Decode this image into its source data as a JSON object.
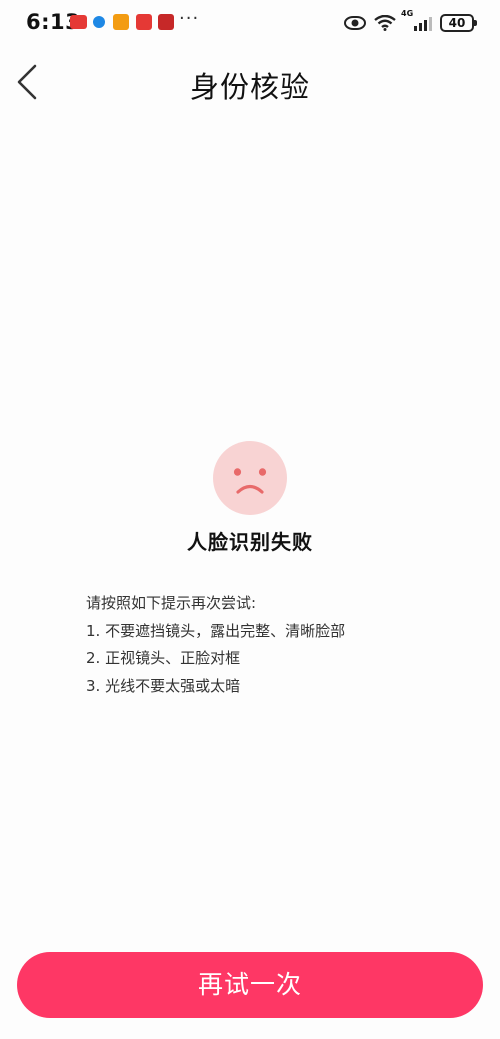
{
  "status_bar": {
    "time": "6:13",
    "network_label": "4G",
    "battery": "40",
    "more": "···",
    "notification_icons": [
      "toutiao-app-icon",
      "browser-app-icon",
      "video-app-icon",
      "read-app-icon",
      "book-app-icon"
    ]
  },
  "header": {
    "title": "身份核验"
  },
  "result": {
    "title": "人脸识别失败",
    "face_color": "#f8d3d3",
    "face_feature_color": "#e86a6a"
  },
  "tips": {
    "intro": "请按照如下提示再次尝试:",
    "items": [
      "1. 不要遮挡镜头，露出完整、清晰脸部",
      "2. 正视镜头、正脸对框",
      "3. 光线不要太强或太暗"
    ]
  },
  "actions": {
    "retry_label": "再试一次",
    "retry_color": "#fe3765"
  }
}
